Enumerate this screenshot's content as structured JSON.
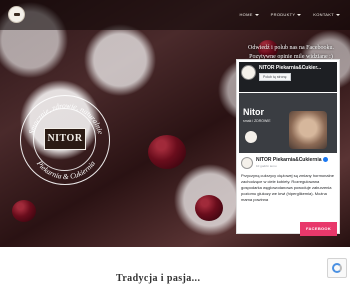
{
  "nav": {
    "items": [
      {
        "label": "HOME"
      },
      {
        "label": "PRODUKTY"
      },
      {
        "label": "KONTAKT"
      }
    ]
  },
  "hero": {
    "logo_center_text": "NITOR",
    "logo_ring_top": "Smacznie, zdrowie, naturalnie",
    "logo_ring_bottom": "Piekarnia & Cukiernia",
    "right_text_line1": "Odwiedź i polub nas na Facebooku.",
    "right_text_line2": "Pozytywne opinie mile widziane :)"
  },
  "facebook_widget": {
    "page_name": "NITOR Piekarnia&Cukier...",
    "follow_button": "Polub tą stronę",
    "image_title": "Nitor",
    "image_subtitle": "smak i ZDROWIE",
    "post_author": "NITOR Piekarnia&Cukiernia",
    "post_time": "10 godzin temu",
    "post_text": "Przyczyną cukrzycy ciężowej są zmiany hormonalne zachodzące w ciele kobiety. Rozregulowana gospodarka węglowodanowa powoduje zaburzenia poziomu glukozy we krwi (hiperglikemia). Można mama powinna"
  },
  "facebook_button": "FACEBOOK",
  "bottom": {
    "title": "Tradycja i pasja..."
  },
  "colors": {
    "accent": "#e8386b",
    "fb_blue": "#1877f2"
  }
}
